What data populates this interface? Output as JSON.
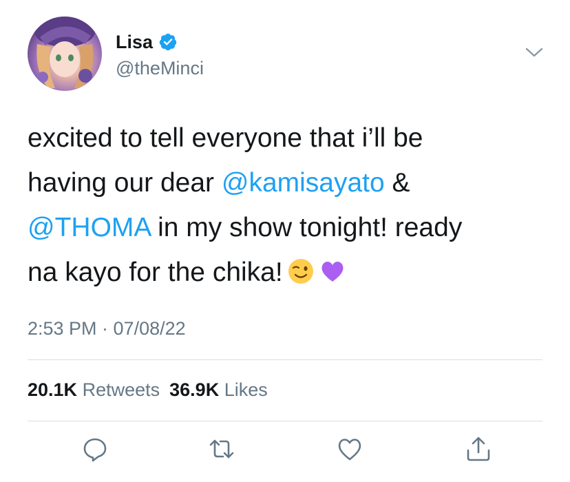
{
  "tweet": {
    "author": {
      "display_name": "Lisa",
      "handle": "@theMinci",
      "verified": true
    },
    "text": {
      "line1": "excited to tell everyone that i’ll be",
      "line2_prefix": "having our dear ",
      "mention1": "@kamisayato",
      "line2_suffix": " &",
      "mention2": "@THOMA",
      "line3_suffix": " in my show tonight! ready",
      "line4": "na kayo for the chika!",
      "emojis": [
        "winking-face",
        "purple-heart"
      ]
    },
    "timestamp": "2:53 PM · 07/08/22",
    "stats": {
      "retweets_count": "20.1K",
      "retweets_label": "Retweets",
      "likes_count": "36.9K",
      "likes_label": "Likes"
    },
    "actions": [
      "reply-icon",
      "retweet-icon",
      "like-icon",
      "share-icon"
    ]
  },
  "colors": {
    "text": "#14171a",
    "secondary": "#657786",
    "accent": "#1da1f2",
    "divider": "#d9dee3"
  }
}
